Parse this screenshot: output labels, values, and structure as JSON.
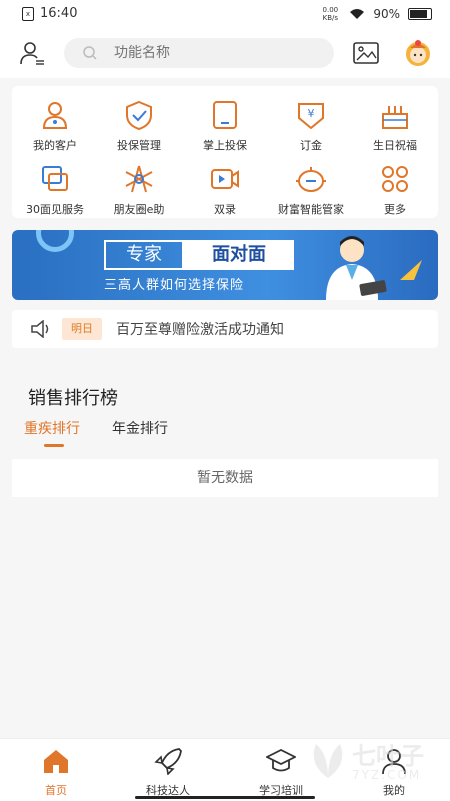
{
  "status": {
    "time": "16:40",
    "battery": "90%",
    "net": "0.00 KB/s"
  },
  "search": {
    "placeholder": "功能名称"
  },
  "grid": [
    {
      "label": "我的客户",
      "icon": "person-icon"
    },
    {
      "label": "投保管理",
      "icon": "shield-check-icon"
    },
    {
      "label": "掌上投保",
      "icon": "tablet-icon"
    },
    {
      "label": "订金",
      "icon": "yen-bag-icon"
    },
    {
      "label": "生日祝福",
      "icon": "cake-icon"
    },
    {
      "label": "30面见服务",
      "icon": "meeting-icon"
    },
    {
      "label": "朋友圈e助",
      "icon": "aperture-icon"
    },
    {
      "label": "双录",
      "icon": "video-icon"
    },
    {
      "label": "财富智能管家",
      "icon": "robot-icon"
    },
    {
      "label": "更多",
      "icon": "more-grid-icon"
    }
  ],
  "banner": {
    "badge1": "专家",
    "badge2": "面对面",
    "subtitle": "三高人群如何选择保险"
  },
  "notice": {
    "tag": "明日",
    "message": "百万至尊赠险激活成功通知"
  },
  "ranking": {
    "title": "销售排行榜",
    "tabs": [
      "重疾排行",
      "年金排行"
    ],
    "active_tab": 0,
    "empty": "暂无数据"
  },
  "nav": [
    {
      "label": "首页",
      "icon": "home-icon",
      "active": true
    },
    {
      "label": "科技达人",
      "icon": "rocket-icon",
      "active": false
    },
    {
      "label": "学习培训",
      "icon": "graduation-cap-icon",
      "active": false
    },
    {
      "label": "我的",
      "icon": "profile-icon",
      "active": false
    }
  ],
  "watermark": {
    "name": "七叶子",
    "site": "7YZ.COM"
  },
  "colors": {
    "accent": "#e0762a",
    "banner_blue": "#2a6fc1"
  }
}
